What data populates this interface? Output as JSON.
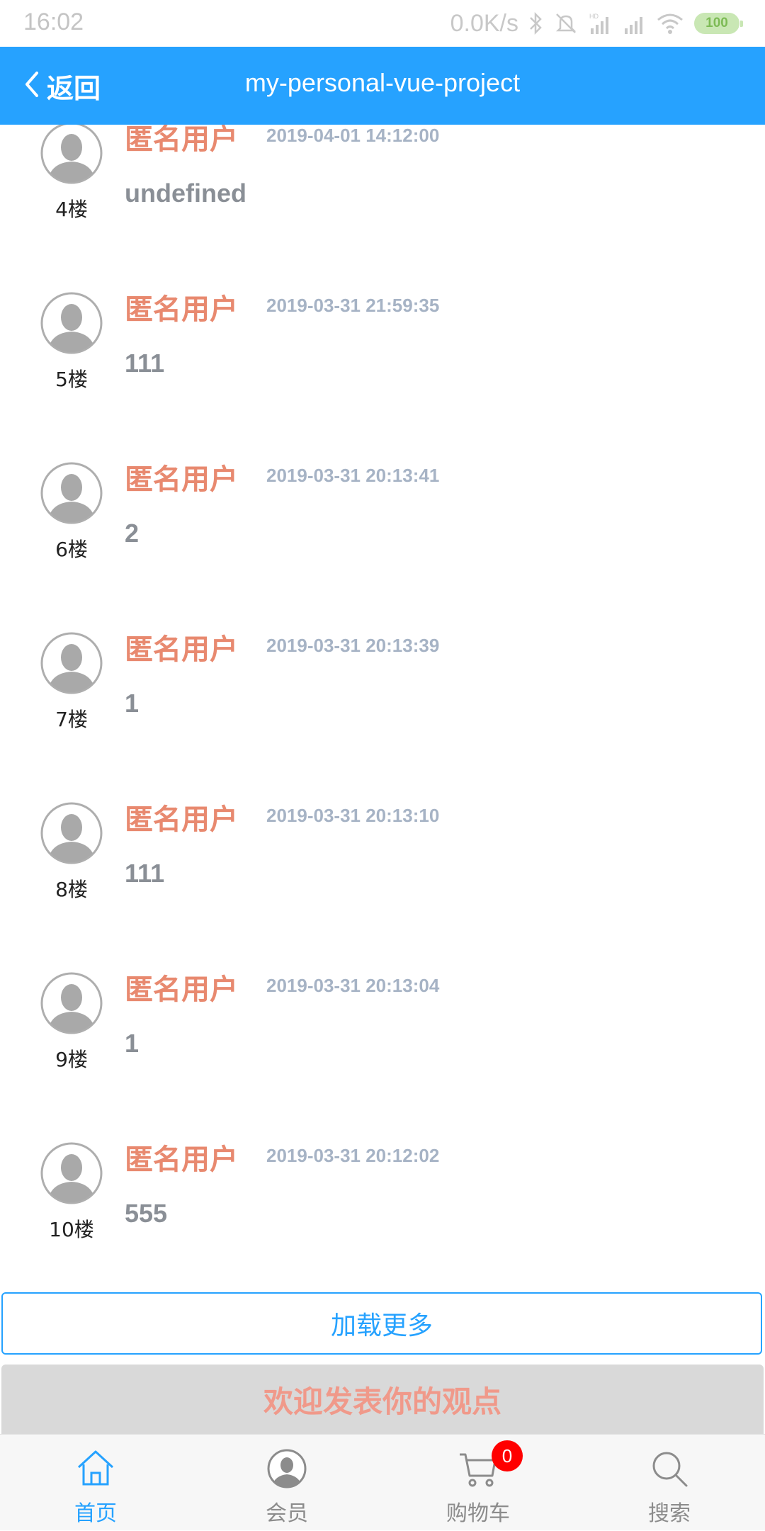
{
  "status_bar": {
    "time": "16:02",
    "network_speed": "0.0K/s",
    "battery": "100",
    "icons": [
      "bluetooth-icon",
      "mute-icon",
      "hd-signal-icon",
      "signal-icon",
      "wifi-icon",
      "battery-icon"
    ]
  },
  "header": {
    "back_label": "返回",
    "title": "my-personal-vue-project",
    "background_color": "#26a2ff"
  },
  "comments": [
    {
      "floor": "4楼",
      "user": "匿名用户",
      "time": "2019-04-01 14:12:00",
      "content": "undefined"
    },
    {
      "floor": "5楼",
      "user": "匿名用户",
      "time": "2019-03-31 21:59:35",
      "content": "111"
    },
    {
      "floor": "6楼",
      "user": "匿名用户",
      "time": "2019-03-31 20:13:41",
      "content": "2"
    },
    {
      "floor": "7楼",
      "user": "匿名用户",
      "time": "2019-03-31 20:13:39",
      "content": "1"
    },
    {
      "floor": "8楼",
      "user": "匿名用户",
      "time": "2019-03-31 20:13:10",
      "content": "111"
    },
    {
      "floor": "9楼",
      "user": "匿名用户",
      "time": "2019-03-31 20:13:04",
      "content": "1"
    },
    {
      "floor": "10楼",
      "user": "匿名用户",
      "time": "2019-03-31 20:12:02",
      "content": "555"
    }
  ],
  "load_more_label": "加载更多",
  "post_opinion_label": "欢迎发表你的观点",
  "tabbar": {
    "tabs": [
      {
        "label": "首页",
        "icon": "home-icon",
        "active": true
      },
      {
        "label": "会员",
        "icon": "member-icon",
        "active": false
      },
      {
        "label": "购物车",
        "icon": "cart-icon",
        "active": false,
        "badge": "0"
      },
      {
        "label": "搜索",
        "icon": "search-icon",
        "active": false
      }
    ]
  }
}
